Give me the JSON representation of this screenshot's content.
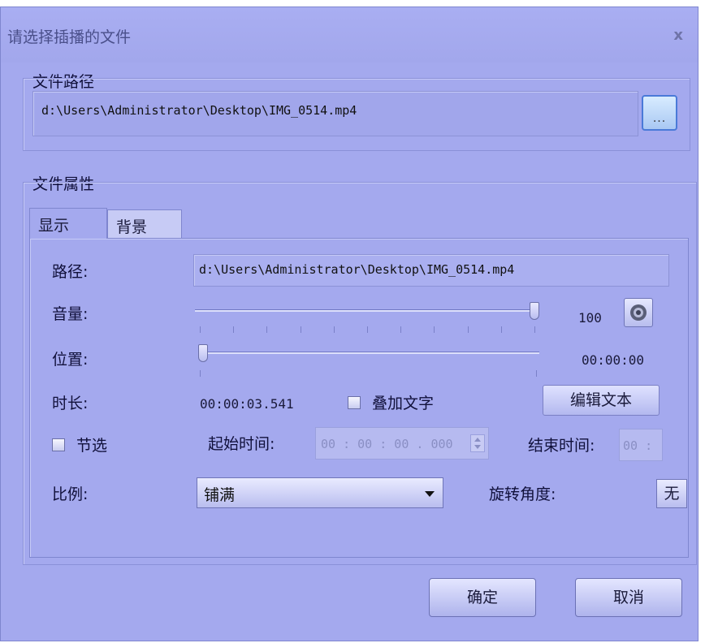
{
  "dialog": {
    "title": "请选择插播的文件",
    "close_glyph": "x"
  },
  "file_path_group": {
    "label": "文件路径",
    "path_value": "d:\\Users\\Administrator\\Desktop\\IMG_0514.mp4",
    "browse_label": "..."
  },
  "properties_group": {
    "label": "文件属性",
    "tabs": [
      {
        "label": "显示",
        "active": true
      },
      {
        "label": "背景",
        "active": false
      }
    ]
  },
  "display_tab": {
    "path_label": "路径:",
    "path_value": "d:\\Users\\Administrator\\Desktop\\IMG_0514.mp4",
    "volume_label": "音量:",
    "volume_value": "100",
    "volume_level": 1.0,
    "speaker_icon": "speaker-icon",
    "position_label": "位置:",
    "position_value": "00:00:00",
    "position_level": 0.0,
    "duration_label": "时长:",
    "duration_value": "00:00:03.541",
    "overlay_text_label": "叠加文字",
    "overlay_text_checked": false,
    "edit_text_label": "编辑文本",
    "segment_label": "节选",
    "segment_checked": false,
    "start_time_label": "起始时间:",
    "start_time_value": "00 : 00 : 00 . 000",
    "end_time_label": "结束时间:",
    "end_time_value": "00 :",
    "ratio_label": "比例:",
    "ratio_value": "铺满",
    "rotation_label": "旋转角度:",
    "rotation_value": "无"
  },
  "footer": {
    "ok_label": "确定",
    "cancel_label": "取消"
  },
  "colors": {
    "dialog_bg": "#a4a9ee",
    "border": "#7f86cf",
    "browse_accent": "#4a7ad8"
  }
}
